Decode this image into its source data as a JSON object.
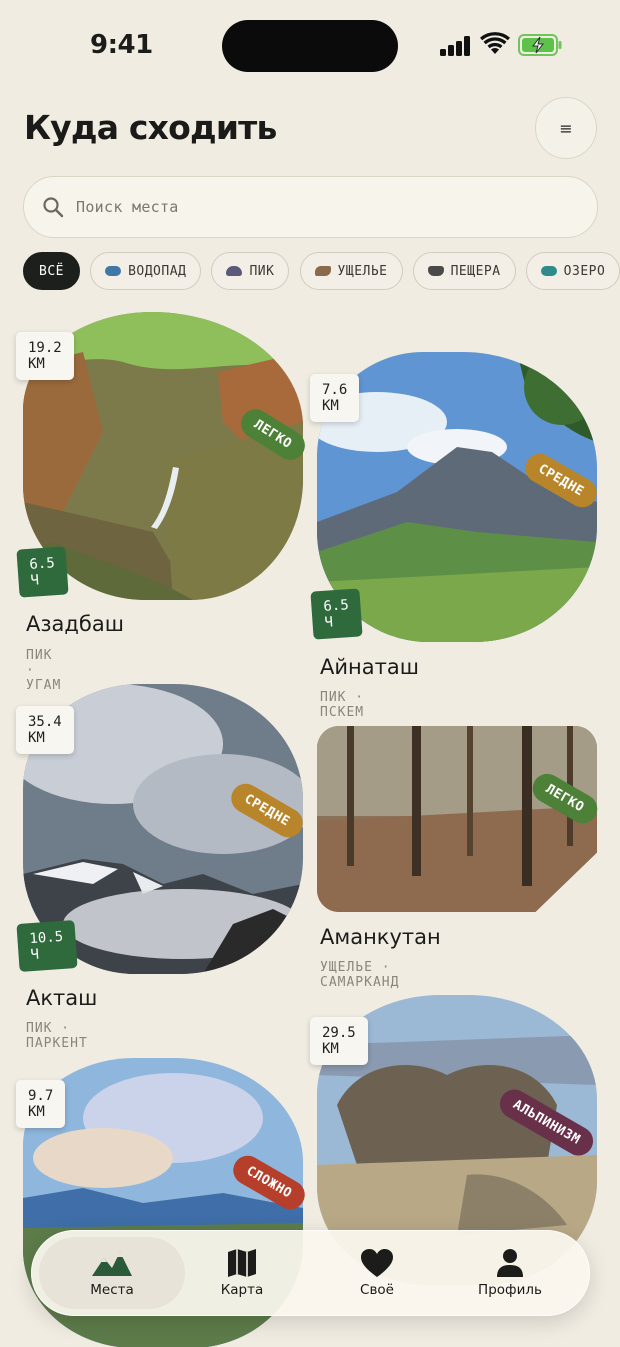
{
  "status_bar": {
    "time": "9:41"
  },
  "header": {
    "title": "Куда сходить",
    "menu_icon": "≡"
  },
  "search": {
    "placeholder": "Поиск места"
  },
  "filters": [
    {
      "label": "ВСЁ",
      "active": true,
      "color": ""
    },
    {
      "label": "ВОДОПАД",
      "active": false,
      "color": "#3f77a6"
    },
    {
      "label": "ПИК",
      "active": false,
      "color": "#5a5a7a"
    },
    {
      "label": "УЩЕЛЬЕ",
      "active": false,
      "color": "#8a6a4a"
    },
    {
      "label": "ПЕЩЕРА",
      "active": false,
      "color": "#4a4a4a"
    },
    {
      "label": "ОЗЕРО",
      "active": false,
      "color": "#2f8a8a"
    }
  ],
  "places": [
    {
      "name": "Азадбаш",
      "meta": "ПИК · УГАМ",
      "distance": "19.2 КМ",
      "duration": "6.5 Ч",
      "difficulty": "ЛЕГКО"
    },
    {
      "name": "Айнаташ",
      "meta": "ПИК · ПСКЕМ",
      "distance": "7.6 КМ",
      "duration": "6.5 Ч",
      "difficulty": "СРЕДНЕ"
    },
    {
      "name": "Акташ",
      "meta": "ПИК · ПАРКЕНТ",
      "distance": "35.4 КМ",
      "duration": "10.5 Ч",
      "difficulty": "СРЕДНЕ"
    },
    {
      "name": "Аманкутан",
      "meta": "УЩЕЛЬЕ · САМАРКАНД",
      "distance": "",
      "duration": "",
      "difficulty": "ЛЕГКО"
    },
    {
      "name": "",
      "meta": "",
      "distance": "9.7 КМ",
      "duration": "",
      "difficulty": "СЛОЖНО"
    },
    {
      "name": "",
      "meta": "",
      "distance": "29.5 КМ",
      "duration": "",
      "difficulty": "АЛЬПИНИЗМ"
    }
  ],
  "tabs": [
    {
      "label": "Места",
      "icon": "mountains-icon",
      "active": true
    },
    {
      "label": "Карта",
      "icon": "map-icon",
      "active": false
    },
    {
      "label": "Своё",
      "icon": "heart-icon",
      "active": false
    },
    {
      "label": "Профиль",
      "icon": "person-icon",
      "active": false
    }
  ],
  "colors": {
    "background": "#f0ece2",
    "easy": "#4d8138",
    "medium": "#b9852a",
    "hard": "#b63f2b",
    "alpinism": "#69304a",
    "duration_badge": "#2f6a3c"
  }
}
